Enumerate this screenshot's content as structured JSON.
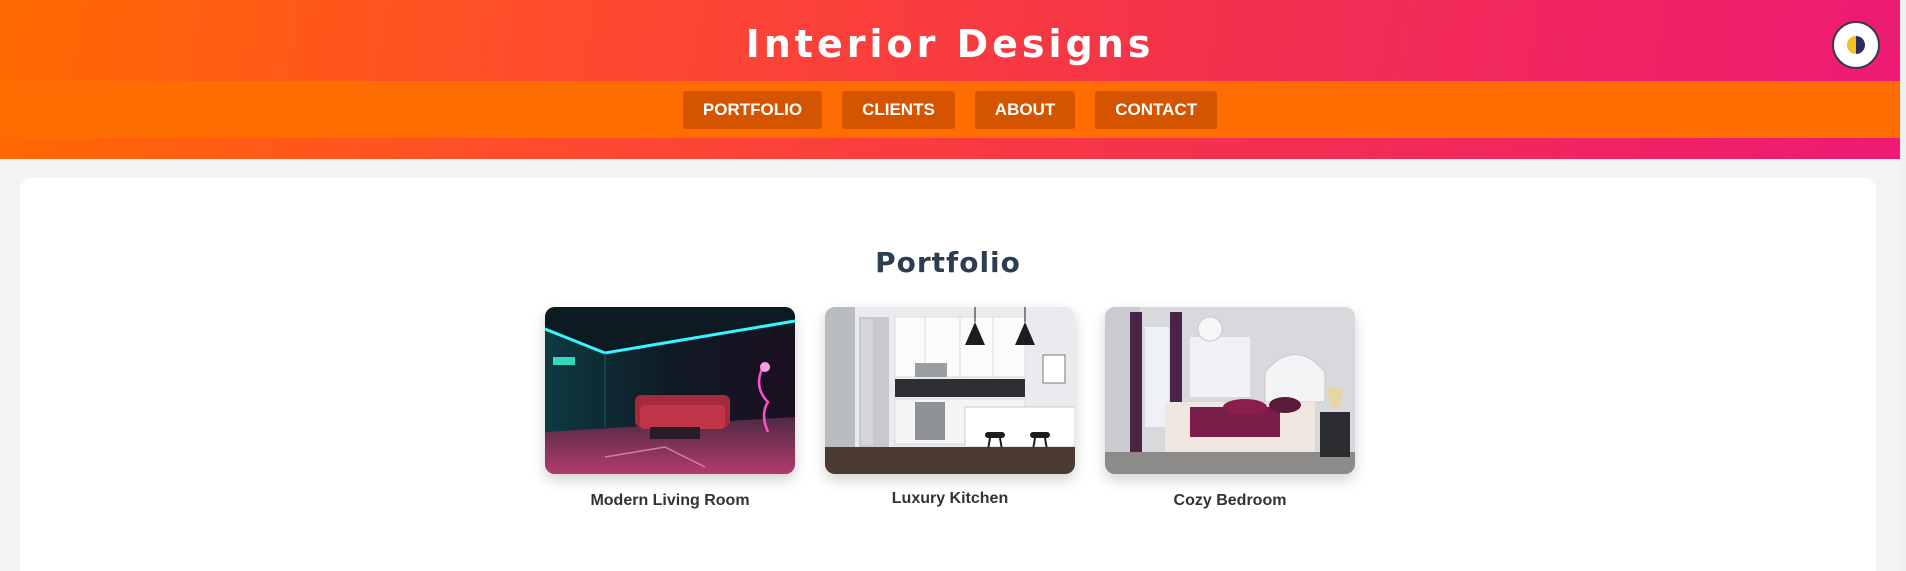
{
  "header": {
    "title": "Interior Designs",
    "theme_toggle_icon": "half-moon-icon",
    "gradient_colors": [
      "#ff6a00",
      "#ee1a74"
    ]
  },
  "nav": {
    "items": [
      {
        "label": "PORTFOLIO"
      },
      {
        "label": "CLIENTS"
      },
      {
        "label": "ABOUT"
      },
      {
        "label": "CONTACT"
      }
    ],
    "button_color": "#d45400"
  },
  "main": {
    "section_title": "Portfolio",
    "gallery": [
      {
        "caption": "Modern Living Room",
        "image": "neon-living-room-photo"
      },
      {
        "caption": "Luxury Kitchen",
        "image": "white-kitchen-photo"
      },
      {
        "caption": "Cozy Bedroom",
        "image": "bedroom-photo"
      }
    ]
  }
}
